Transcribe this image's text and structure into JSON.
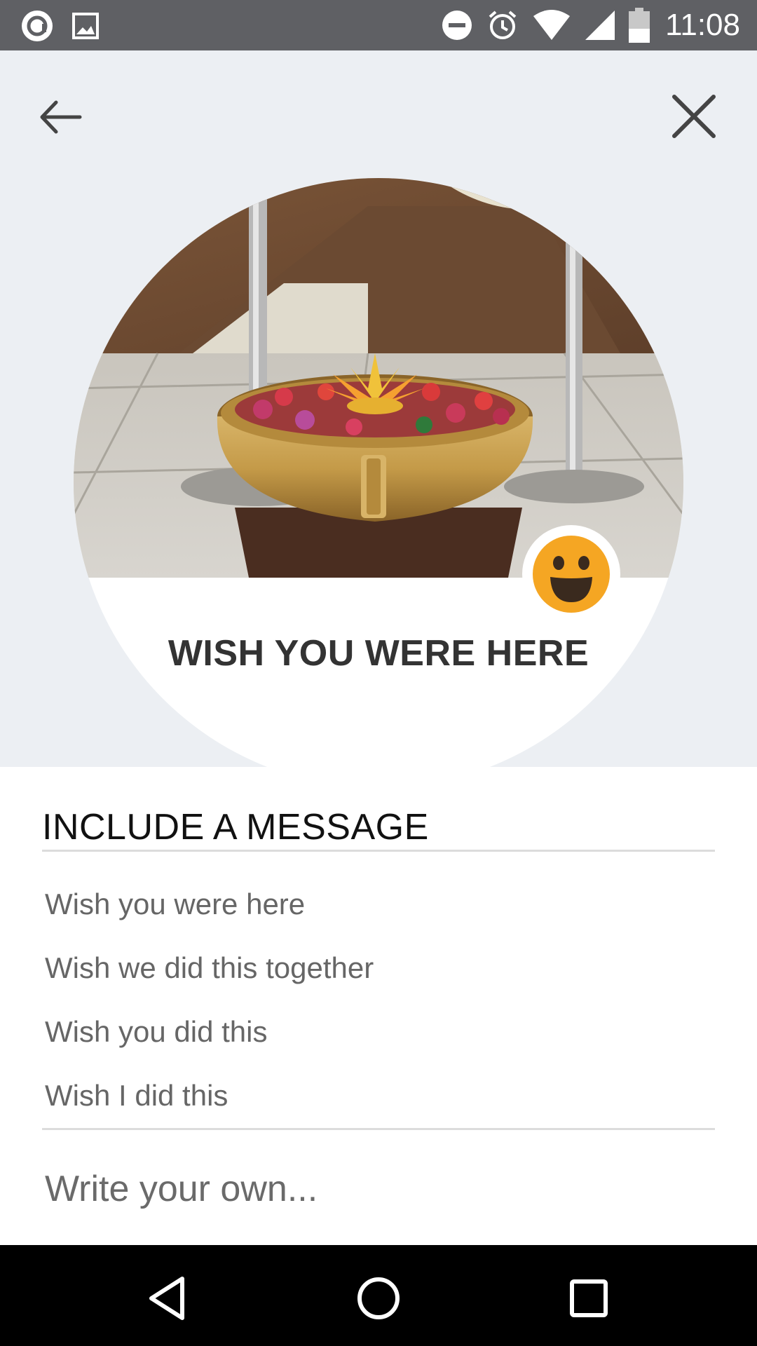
{
  "status_bar": {
    "time": "11:08",
    "left_icons": [
      "app-notification-icon",
      "image-notification-icon"
    ],
    "right_icons": [
      "do-not-disturb-icon",
      "alarm-icon",
      "wifi-icon",
      "cell-signal-icon",
      "battery-icon"
    ]
  },
  "header": {
    "back_icon": "arrow-left-icon",
    "close_icon": "close-icon"
  },
  "card": {
    "title": "WISH YOU WERE HERE",
    "emoji": "grinning-face-icon",
    "emoji_color": "#f5a623"
  },
  "message": {
    "heading": "INCLUDE A MESSAGE",
    "suggestions": [
      "Wish you were here",
      "Wish we did this together",
      "Wish you did this",
      "Wish I did this"
    ],
    "custom_placeholder": "Write your own..."
  },
  "nav_bar": {
    "buttons": [
      "back-triangle-icon",
      "home-circle-icon",
      "recents-square-icon"
    ]
  }
}
